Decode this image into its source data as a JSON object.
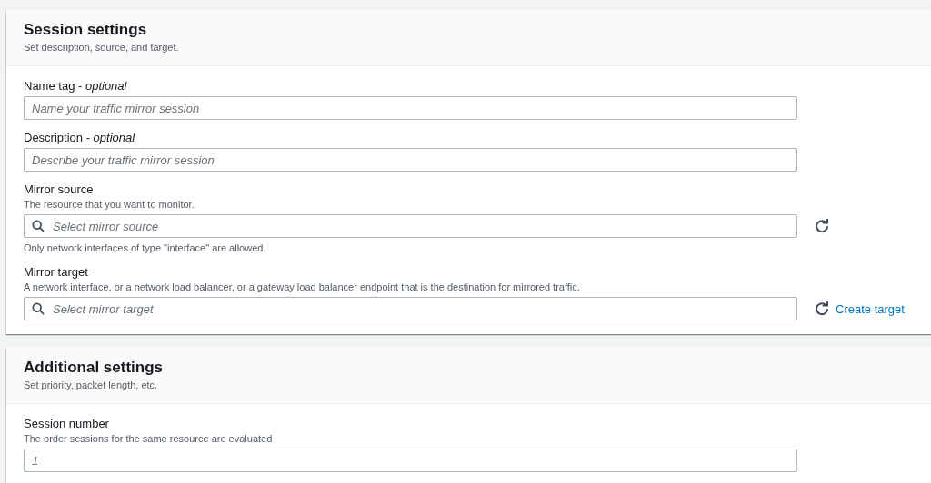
{
  "sections": [
    {
      "title": "Session settings",
      "description": "Set description, source, and target.",
      "fields": [
        {
          "label": "Name tag - *optional*",
          "kind": "text",
          "placeholder": "Name your traffic mirror session"
        },
        {
          "label": "Description - *optional*",
          "kind": "text",
          "placeholder": "Describe your traffic mirror session"
        },
        {
          "label": "Mirror source",
          "hint": "The resource that you want to monitor.",
          "kind": "select",
          "placeholder": "Select mirror source",
          "refresh": true,
          "footnote": "Only network interfaces of type \"interface\" are allowed."
        },
        {
          "label": "Mirror target",
          "hint": "A network interface, or a network load balancer, or a gateway load balancer endpoint that is the destination for mirrored traffic.",
          "kind": "select",
          "placeholder": "Select mirror target",
          "refresh": true,
          "link": "Create target"
        }
      ]
    },
    {
      "title": "Additional settings",
      "description": "Set priority, packet length, etc.",
      "fields": [
        {
          "label": "Session number",
          "hint": "The order sessions for the same resource are evaluated",
          "kind": "text",
          "placeholder": "1"
        }
      ]
    }
  ]
}
